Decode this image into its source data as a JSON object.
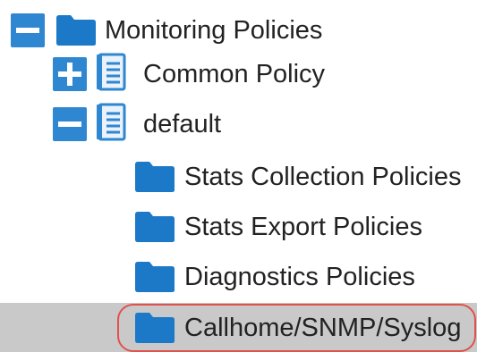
{
  "tree": {
    "root": {
      "label": "Monitoring Policies",
      "toggle": "collapse",
      "icon": "folder-icon"
    },
    "children": [
      {
        "label": "Common Policy",
        "toggle": "expand",
        "icon": "policy-document-icon"
      },
      {
        "label": "default",
        "toggle": "collapse",
        "icon": "policy-document-icon"
      }
    ],
    "default_children": [
      {
        "label": "Stats Collection Policies",
        "icon": "folder-icon"
      },
      {
        "label": "Stats Export Policies",
        "icon": "folder-icon"
      },
      {
        "label": "Diagnostics Policies",
        "icon": "folder-icon"
      },
      {
        "label": "Callhome/SNMP/Syslog",
        "icon": "folder-icon",
        "selected": true
      }
    ]
  },
  "colors": {
    "accent": "#2f86d1",
    "selected_row": "#c9c9c9",
    "highlight_ring": "#e0524d"
  }
}
